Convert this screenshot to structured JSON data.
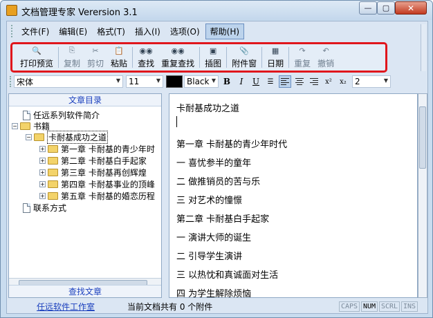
{
  "window": {
    "title": "文档管理专家 Verersion 3.1",
    "min": "—",
    "max": "▢",
    "close": "✕"
  },
  "menu": [
    "文件(F)",
    "编辑(E)",
    "格式(T)",
    "插入(I)",
    "选项(O)",
    "帮助(H)"
  ],
  "toolbar": {
    "print_preview": "打印预览",
    "copy": "复制",
    "cut": "剪切",
    "paste": "粘贴",
    "find": "查找",
    "find_again": "重复查找",
    "insert_image": "插图",
    "attachments": "附件窗",
    "date": "日期",
    "redo": "重复",
    "undo": "撤销"
  },
  "format": {
    "font": "宋体",
    "size": "11",
    "color_name": "Black",
    "spacing": "2",
    "color_hex": "#000000"
  },
  "left_panel": {
    "title": "文章目录",
    "find_button": "查找文章"
  },
  "tree": [
    {
      "label": "任远系列软件简介"
    },
    {
      "label": "书籍"
    },
    {
      "label": "卡耐基成功之道"
    },
    {
      "label": "第一章  卡耐基的青少年时"
    },
    {
      "label": "第二章  卡耐基白手起家"
    },
    {
      "label": "第三章  卡耐基再创辉煌"
    },
    {
      "label": "第四章  卡耐基事业的顶峰"
    },
    {
      "label": "第五章  卡耐基的婚恋历程"
    },
    {
      "label": "联系方式"
    }
  ],
  "editor_lines": [
    "卡耐基成功之道",
    "第一章  卡耐基的青少年时代",
    "一   喜忧参半的童年",
    "二   做推销员的苦与乐",
    "三   对艺术的憧憬",
    "第二章  卡耐基白手起家",
    "一   演讲大师的诞生",
    "二   引导学生演讲",
    "三   以热忱和真诚面对生活",
    "四   为学生解除烦恼"
  ],
  "status": {
    "link": "任远软件工作室",
    "attachments": "当前文档共有  0 个附件",
    "caps": "CAPS",
    "num": "NUM",
    "scrl": "SCRL",
    "ins": "INS"
  }
}
